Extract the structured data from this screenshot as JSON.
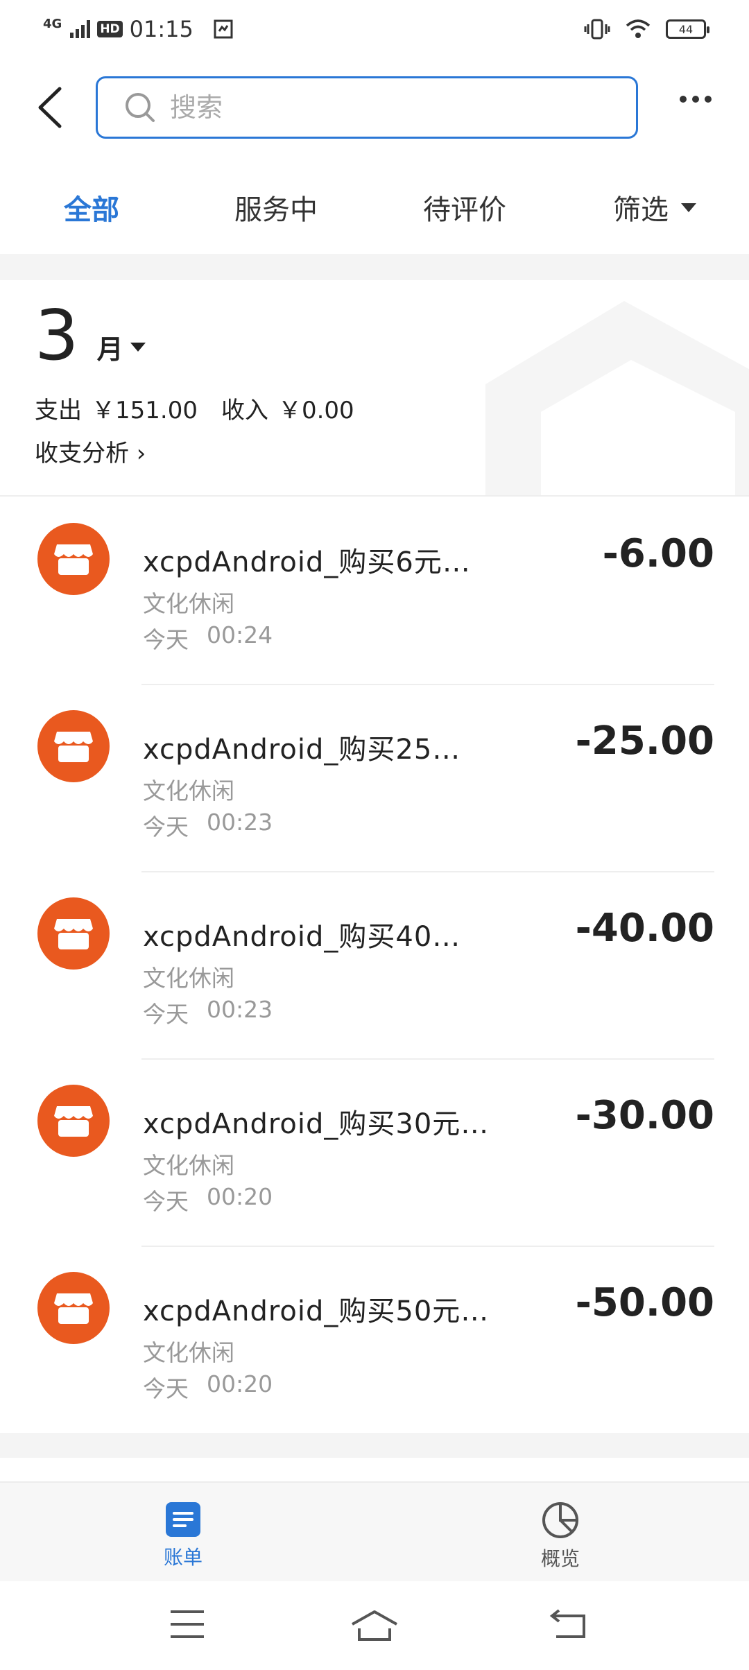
{
  "status_bar": {
    "network": "4G",
    "hd": "HD",
    "time": "01:15",
    "battery": "44"
  },
  "search": {
    "placeholder": "搜索"
  },
  "tabs": [
    {
      "label": "全部"
    },
    {
      "label": "服务中"
    },
    {
      "label": "待评价"
    },
    {
      "label": "筛选"
    }
  ],
  "summary": {
    "month": "3",
    "month_unit": "月",
    "expense_label": "支出",
    "expense_value": "￥151.00",
    "income_label": "收入",
    "income_value": "￥0.00",
    "analysis_label": "收支分析 ›"
  },
  "transactions": [
    {
      "title": "xcpdAndroid_购买6元…",
      "category": "文化休闲",
      "day": "今天",
      "time": "00:24",
      "amount": "-6.00"
    },
    {
      "title": "xcpdAndroid_购买25…",
      "category": "文化休闲",
      "day": "今天",
      "time": "00:23",
      "amount": "-25.00"
    },
    {
      "title": "xcpdAndroid_购买40…",
      "category": "文化休闲",
      "day": "今天",
      "time": "00:23",
      "amount": "-40.00"
    },
    {
      "title": "xcpdAndroid_购买30元…",
      "category": "文化休闲",
      "day": "今天",
      "time": "00:20",
      "amount": "-30.00"
    },
    {
      "title": "xcpdAndroid_购买50元…",
      "category": "文化休闲",
      "day": "今天",
      "time": "00:20",
      "amount": "-50.00"
    }
  ],
  "bottom_nav": [
    {
      "label": "账单",
      "icon": "bill-icon"
    },
    {
      "label": "概览",
      "icon": "pie-chart-icon"
    }
  ],
  "colors": {
    "accent": "#2a77d6",
    "merchant_icon_bg": "#e9591f"
  }
}
